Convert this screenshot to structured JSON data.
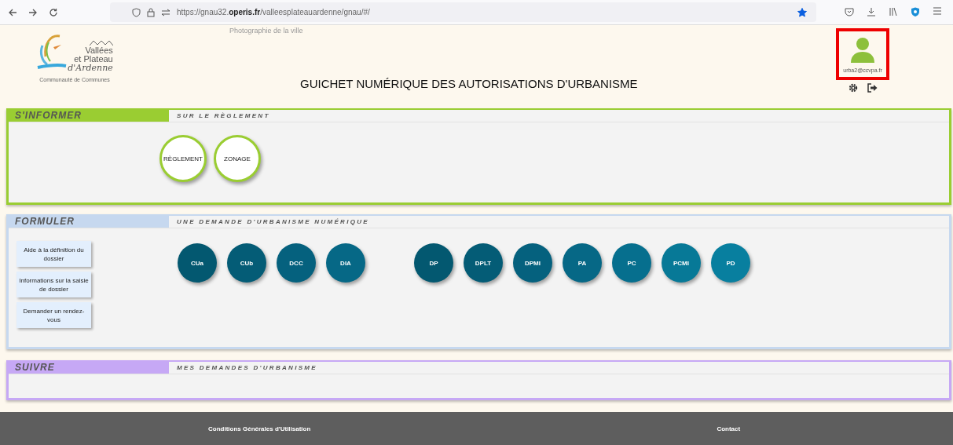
{
  "browser": {
    "url_prefix": "https://gnau32.",
    "url_domain": "operis.fr",
    "url_path": "/valleesplateauardenne/gnau/#/",
    "bookmarked": true
  },
  "header": {
    "photo_caption": "Photographie de la ville",
    "logo_lines": [
      "Vallées",
      "et Plateau",
      "d'Ardenne"
    ],
    "logo_subtitle": "Communauté de Communes",
    "title": "GUICHET NUMÉRIQUE DES AUTORISATIONS D'URBANISME",
    "user": {
      "email": "urba2@ccvpa.fr",
      "highlighted": true
    }
  },
  "sections": [
    {
      "kind": "informer",
      "title": "S'INFORMER",
      "subtitle": "SUR LE RÈGLEMENT",
      "color": "#9acd32",
      "groups": [
        [
          "RÈGLEMENT",
          "ZONAGE"
        ]
      ]
    },
    {
      "kind": "formuler",
      "title": "FORMULER",
      "subtitle": "UNE DEMANDE D'URBANISME NUMÉRIQUE",
      "color": "#c6d8ef",
      "links": [
        "Aide à la définition du dossier",
        "Informations sur la saisie de dossier",
        "Demander un rendez-vous"
      ],
      "groups": [
        [
          "CUa",
          "CUb",
          "DCC",
          "DIA"
        ],
        [
          "DP",
          "DPLT",
          "DPMI",
          "PA",
          "PC",
          "PCMI",
          "PD"
        ]
      ]
    },
    {
      "kind": "suivre",
      "title": "SUIVRE",
      "subtitle": "MES DEMANDES D'URBANISME",
      "color": "#c6a8f5"
    }
  ],
  "footer": [
    "Conditions Générales d'Utilisation",
    "Contact"
  ]
}
